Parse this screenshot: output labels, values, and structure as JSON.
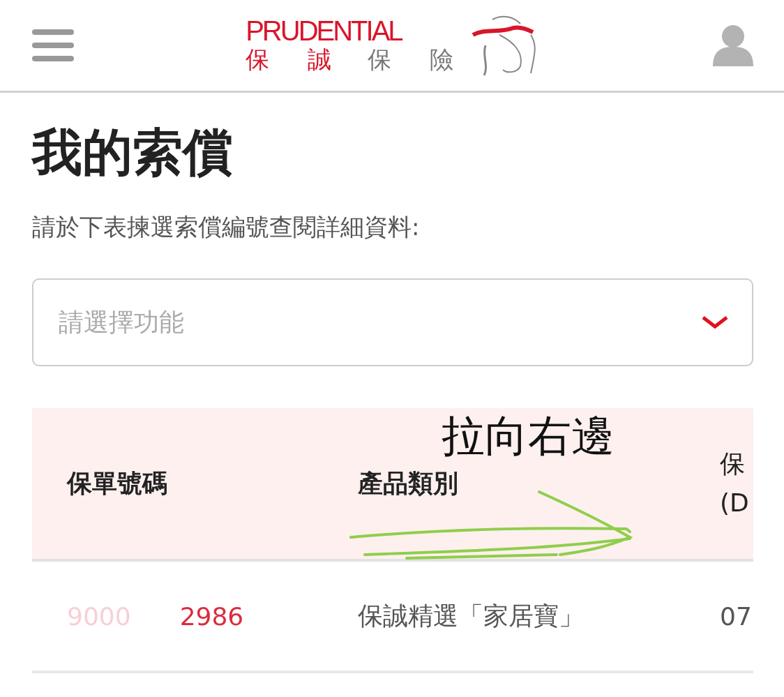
{
  "header": {
    "logo": {
      "wordmark": "PRUDENTIAL",
      "chinese_red": "保 誠",
      "chinese_grey": "保 險"
    }
  },
  "title": "我的索償",
  "instruction": "請於下表揀選索償編號查閱詳細資料:",
  "select": {
    "placeholder": "請選擇功能"
  },
  "table": {
    "columns": [
      {
        "lines": [
          "保單號碼"
        ]
      },
      {
        "lines": [
          "產品類別"
        ]
      },
      {
        "lines": [
          "保",
          "(D"
        ]
      }
    ],
    "rows": [
      {
        "policy_number": {
          "start": "9000",
          "end": "2986"
        },
        "product": "保誠精選「家居寶」",
        "column_3": "07"
      }
    ]
  },
  "annotation": {
    "text": "拉向右邊"
  }
}
